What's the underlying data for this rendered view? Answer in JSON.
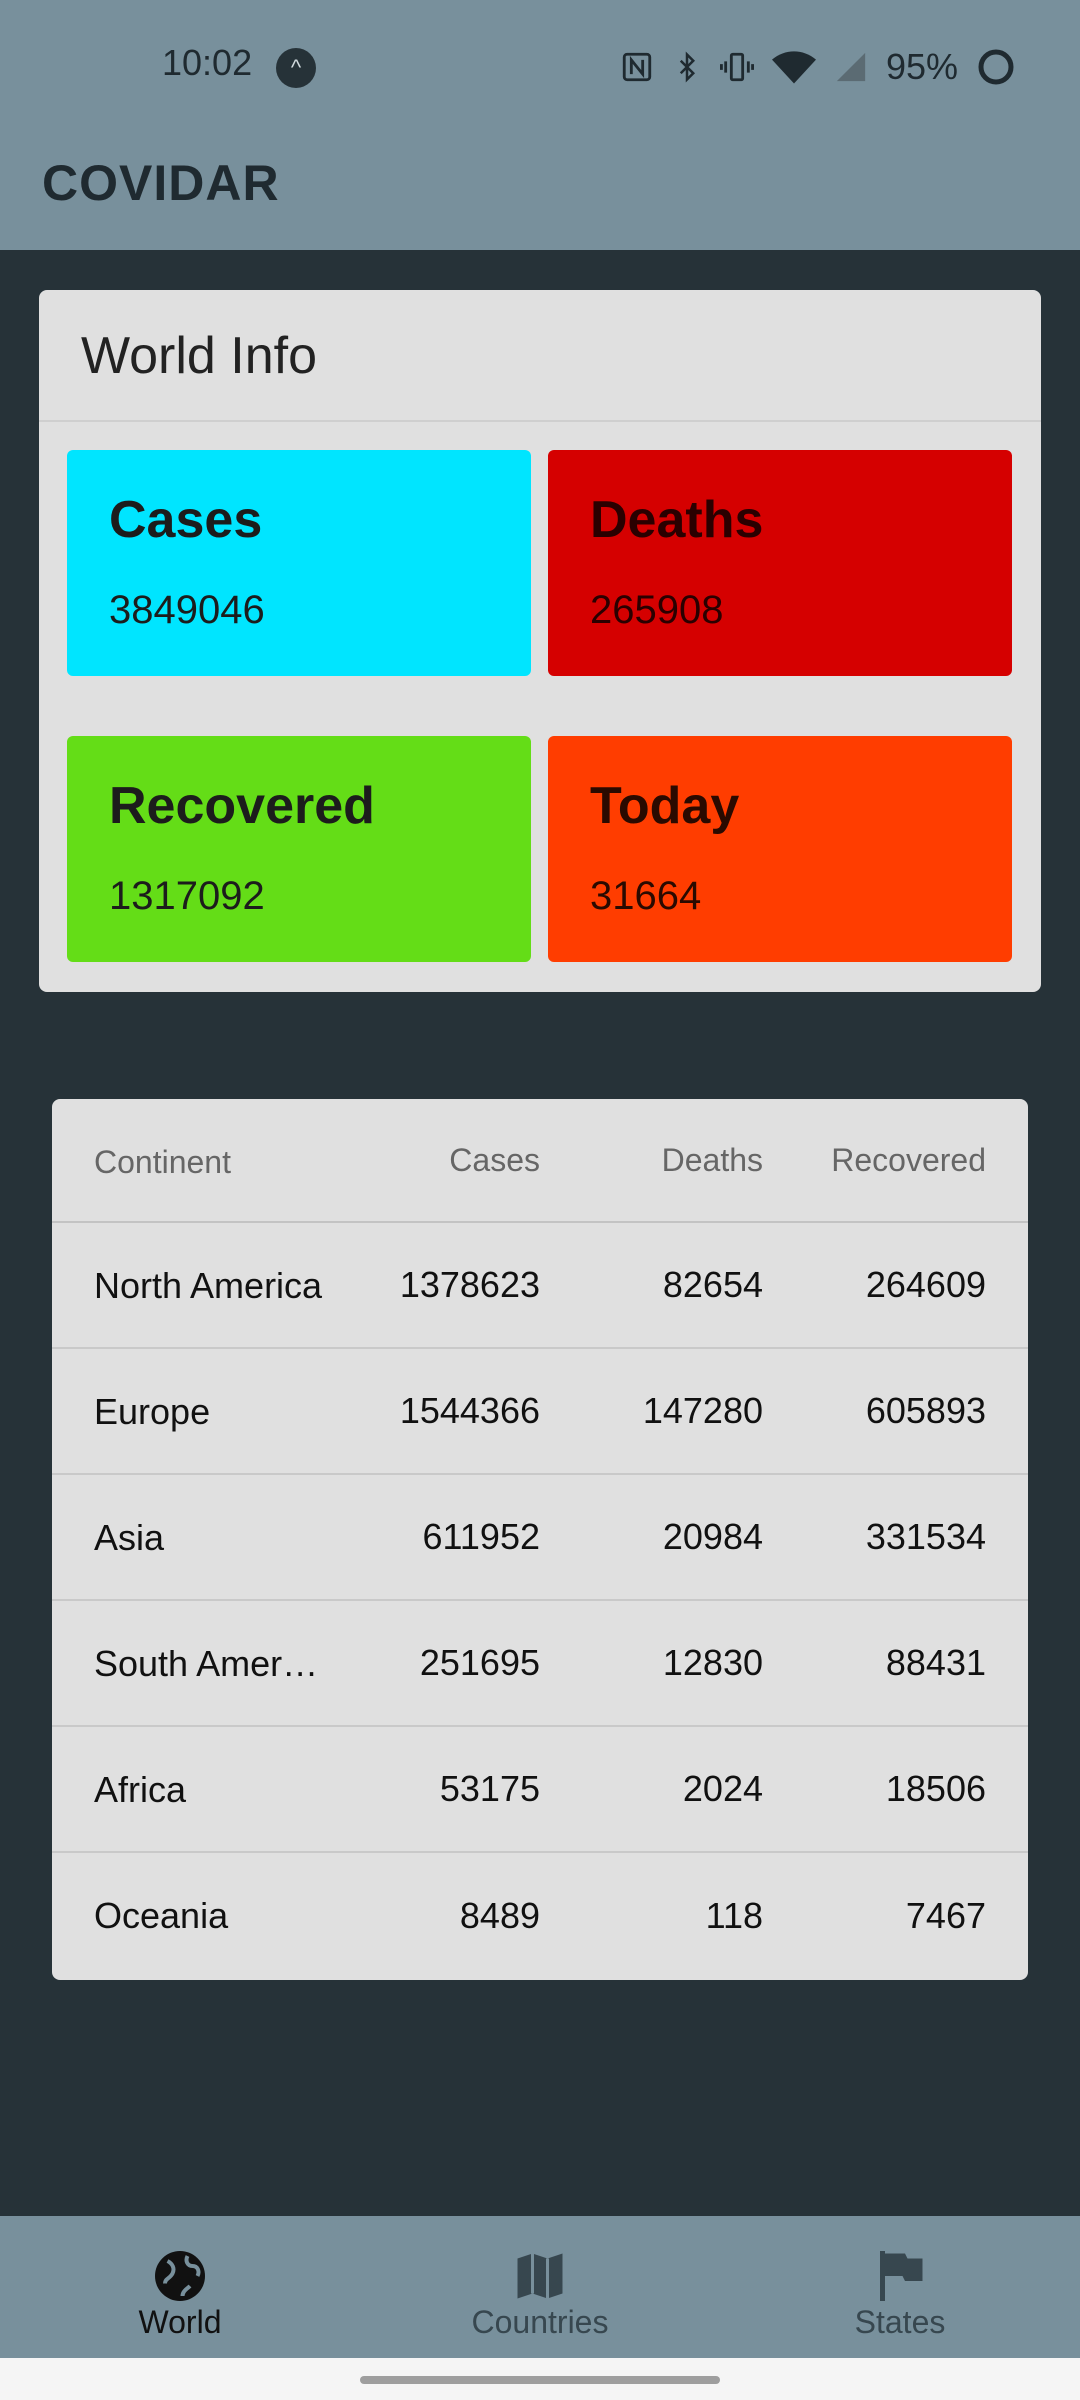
{
  "status_bar": {
    "time": "10:02",
    "battery": "95%",
    "icons": [
      "nfc-icon",
      "bluetooth-icon",
      "vibrate-icon",
      "wifi-icon",
      "signal-icon",
      "battery-icon"
    ]
  },
  "app": {
    "title": "COVIDAR"
  },
  "world_info": {
    "title": "World Info",
    "tiles": {
      "cases": {
        "label": "Cases",
        "value": "3849046",
        "color": "#00e5ff"
      },
      "deaths": {
        "label": "Deaths",
        "value": "265908",
        "color": "#d50000"
      },
      "recovered": {
        "label": "Recovered",
        "value": "1317092",
        "color": "#64dd17"
      },
      "today": {
        "label": "Today",
        "value": "31664",
        "color": "#ff3d00"
      }
    }
  },
  "continent_table": {
    "headers": [
      "Continent",
      "Cases",
      "Deaths",
      "Recovered"
    ],
    "rows": [
      [
        "North America",
        "1378623",
        "82654",
        "264609"
      ],
      [
        "Europe",
        "1544366",
        "147280",
        "605893"
      ],
      [
        "Asia",
        "611952",
        "20984",
        "331534"
      ],
      [
        "South America",
        "251695",
        "12830",
        "88431"
      ],
      [
        "Africa",
        "53175",
        "2024",
        "18506"
      ],
      [
        "Oceania",
        "8489",
        "118",
        "7467"
      ]
    ]
  },
  "bottom_nav": {
    "items": [
      {
        "label": "World",
        "icon": "globe-icon",
        "active": true
      },
      {
        "label": "Countries",
        "icon": "map-icon",
        "active": false
      },
      {
        "label": "States",
        "icon": "flag-icon",
        "active": false
      }
    ]
  },
  "colors": {
    "appbar": "#78909c",
    "background": "#263238",
    "card": "#e0e0e0"
  }
}
